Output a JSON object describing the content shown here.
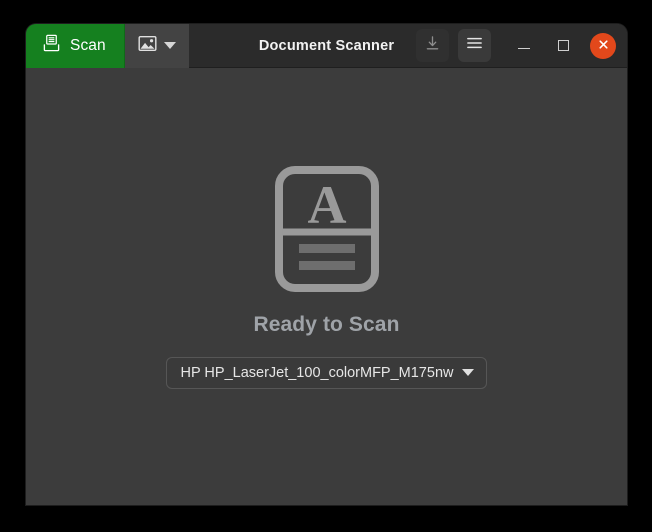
{
  "window": {
    "title": "Document Scanner"
  },
  "header": {
    "scan_button": {
      "label": "Scan",
      "icon": "scanner-icon",
      "color": "#15801f"
    },
    "source_button": {
      "icon": "picture-icon",
      "caret": "chevron-down-icon"
    },
    "save_button": {
      "icon": "save-download-icon",
      "enabled": false
    },
    "menu_button": {
      "icon": "hamburger-menu-icon"
    },
    "window_controls": {
      "minimize": "minimize-icon",
      "maximize": "maximize-icon",
      "close": "close-icon",
      "close_color": "#e2481b"
    }
  },
  "main": {
    "placeholder_icon": "document-page-icon",
    "status": "Ready to Scan",
    "device_selector": {
      "value": "HP HP_LaserJet_100_colorMFP_M175nw",
      "caret": "chevron-down-icon"
    }
  }
}
